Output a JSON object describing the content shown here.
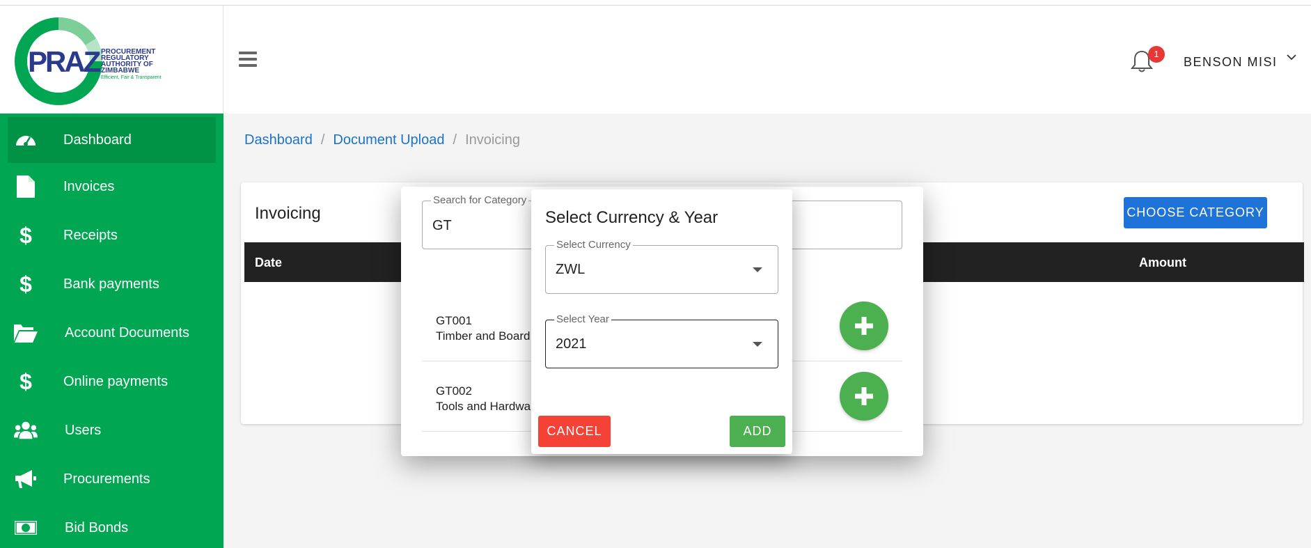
{
  "logo": {
    "word": "PRAZ",
    "lines": [
      "PROCUREMENT",
      "REGULATORY",
      "AUTHORITY OF",
      "ZIMBABWE"
    ],
    "tagline": "Efficient, Fair & Transparent"
  },
  "header": {
    "notification_count": "1",
    "username": "BENSON MISI"
  },
  "sidebar": {
    "items": [
      {
        "label": "Dashboard",
        "icon": "dashboard-icon"
      },
      {
        "label": "Invoices",
        "icon": "file-icon"
      },
      {
        "label": "Receipts",
        "icon": "dollar-icon"
      },
      {
        "label": "Bank payments",
        "icon": "dollar-icon"
      },
      {
        "label": "Account Documents",
        "icon": "folder-open-icon"
      },
      {
        "label": "Online payments",
        "icon": "dollar-icon"
      },
      {
        "label": "Users",
        "icon": "users-icon"
      },
      {
        "label": "Procurements",
        "icon": "megaphone-icon"
      },
      {
        "label": "Bid Bonds",
        "icon": "money-bill-icon"
      }
    ]
  },
  "breadcrumb": {
    "items": [
      "Dashboard",
      "Document Upload"
    ],
    "separator": "/",
    "current": "Invoicing"
  },
  "main": {
    "title": "Invoicing",
    "choose_category_label": "CHOOSE CATEGORY",
    "table_headers": {
      "date": "Date",
      "amount": "Amount"
    }
  },
  "category_dialog": {
    "search_label": "Search for Category",
    "search_value": "GT",
    "rows": [
      {
        "code": "GT001",
        "name": "Timber and Board"
      },
      {
        "code": "GT002",
        "name": "Tools and Hardwa"
      }
    ]
  },
  "currency_dialog": {
    "title": "Select Currency & Year",
    "currency_label": "Select Currency",
    "currency_value": "ZWL",
    "year_label": "Select Year",
    "year_value": "2021",
    "cancel_label": "CANCEL",
    "add_label": "ADD"
  },
  "colors": {
    "sidebar": "#00a651",
    "sidebar_active": "#009245",
    "primary_button": "#1e73d8",
    "cancel_button": "#f44336",
    "add_button": "#4caf50",
    "badge": "#e53935"
  }
}
